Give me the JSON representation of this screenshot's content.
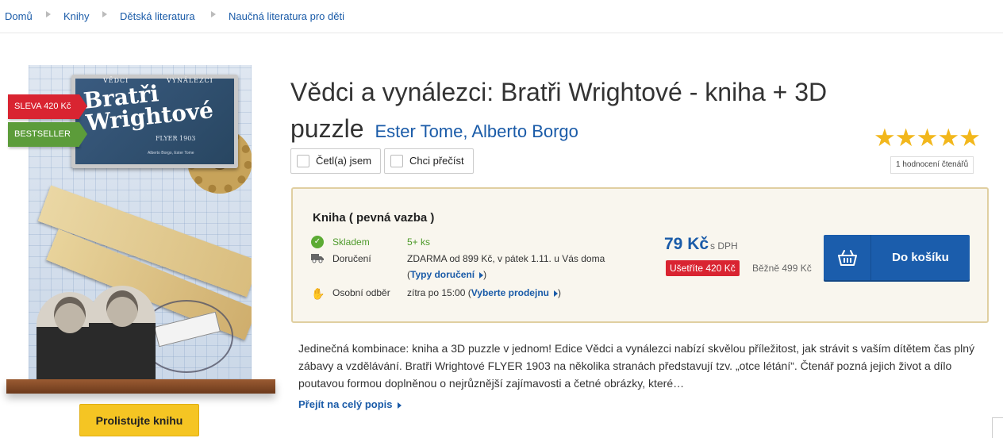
{
  "breadcrumb": [
    "Domů",
    "Knihy",
    "Dětská literatura",
    "Naučná literatura pro děti"
  ],
  "cover": {
    "top_left": "VĚDCI",
    "top_right": "VYNÁLEZCI",
    "title_line1": "Bratři",
    "title_line2": "Wrightové",
    "subtitle": "FLYER 1903",
    "small_authors": "Alberto Borgo, Ester Tome",
    "badges": {
      "sale": "SLEVA 420 Kč",
      "bestseller": "BESTSELLER"
    },
    "browse_button": "Prolistujte knihu"
  },
  "product": {
    "title": "Vědci a vynálezci: Bratři Wrightové - kniha + 3D puzzle",
    "authors": [
      "Ester Tome",
      "Alberto Borgo"
    ],
    "author_separator": ", "
  },
  "reading": {
    "read_label": "Četl(a) jsem",
    "want_label": "Chci přečíst"
  },
  "rating": {
    "stars": 5,
    "max_stars": 5,
    "star_glyph": "★★★★★",
    "count_label": "1 hodnocení čtenářů"
  },
  "buy": {
    "format": "Kniha ( pevná vazba )",
    "stock_label": "Skladem",
    "stock_value": "5+ ks",
    "delivery_label": "Doručení",
    "delivery_value": "ZDARMA od 899 Kč, v pátek 1.11. u Vás doma",
    "delivery_link": "Typy doručení",
    "pickup_label": "Osobní odběr",
    "pickup_value": "zítra po 15:00",
    "pickup_link": "Vyberte prodejnu",
    "price": "79 Kč",
    "price_note": "s DPH",
    "save_label": "Ušetříte 420 Kč",
    "regular_price": "Běžně 499 Kč",
    "cart_button": "Do košíku"
  },
  "description": {
    "text": "Jedinečná kombinace: kniha a 3D puzzle v jednom! Edice Vědci a vynálezci nabízí skvělou příležitost, jak strávit s vaším dítětem čas plný zábavy a vzdělávání. Bratři Wrightové FLYER 1903 na několika stranách představují tzv. „otce létání“. Čtenář pozná jejich život a dílo poutavou formou doplněnou o nejrůznější zajímavosti a četné obrázky, které…",
    "more_link": "Přejít na celý popis"
  },
  "colors": {
    "link": "#1a5ba8",
    "sale_red": "#d92431",
    "bestseller_green": "#5c9c3a",
    "star_gold": "#f2b71c",
    "browse_yellow": "#f5c523",
    "cart_blue": "#1b5dac",
    "buybox_bg": "#f9f6ee",
    "buybox_border": "#e0cfa1"
  },
  "icons": {
    "stock": "check-circle-icon",
    "delivery": "truck-icon",
    "pickup": "hand-icon",
    "cart": "basket-icon",
    "breadcrumb_separator": "arrow-right-icon"
  }
}
